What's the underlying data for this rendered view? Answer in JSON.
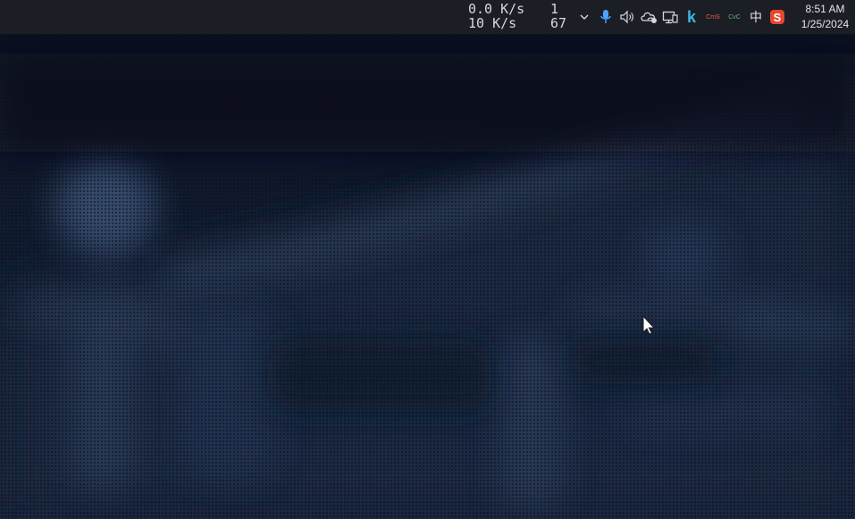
{
  "network_monitor": {
    "upload_speed": "0.0 K/s",
    "upload_count": "1",
    "download_speed": "10 K/s",
    "download_count": "67"
  },
  "tray": {
    "items": [
      {
        "name": "chevron-up-icon",
        "label": ""
      },
      {
        "name": "microphone-icon",
        "label": ""
      },
      {
        "name": "volume-icon",
        "label": ""
      },
      {
        "name": "cloud-sync-icon",
        "label": ""
      },
      {
        "name": "display-network-icon",
        "label": ""
      },
      {
        "name": "k-app-icon",
        "label": "k"
      },
      {
        "name": "cms-app-icon",
        "label": "CmS"
      },
      {
        "name": "cvc-app-icon",
        "label": "CvC"
      },
      {
        "name": "input-method-icon",
        "label": "中"
      },
      {
        "name": "sogou-ime-icon",
        "label": "S"
      }
    ]
  },
  "clock": {
    "time": "8:51 AM",
    "date": "1/25/2024"
  },
  "colors": {
    "taskbar": "#1c1e25",
    "wallpaper_dark": "#0b1324",
    "wallpaper_light": "#2a3a56",
    "accent_blue": "#4aa3ff",
    "sogou_red": "#e8452c"
  }
}
